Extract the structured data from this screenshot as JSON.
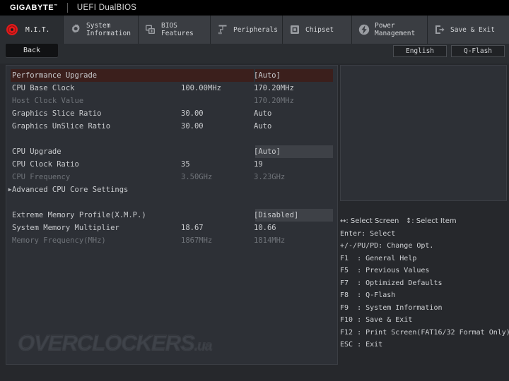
{
  "header": {
    "brand": "GIGABYTE",
    "trademark": "™",
    "subtitle": "UEFI DualBIOS"
  },
  "tabs": [
    {
      "label": "M.I.T.",
      "icon": "target-icon",
      "active": true
    },
    {
      "label": "System\nInformation",
      "icon": "gear-icon",
      "active": false
    },
    {
      "label": "BIOS\nFeatures",
      "icon": "chip-add-icon",
      "active": false
    },
    {
      "label": "Peripherals",
      "icon": "usb-plug-icon",
      "active": false
    },
    {
      "label": "Chipset",
      "icon": "chipset-icon",
      "active": false
    },
    {
      "label": "Power\nManagement",
      "icon": "power-bolt-icon",
      "active": false
    },
    {
      "label": "Save & Exit",
      "icon": "exit-arrow-icon",
      "active": false
    }
  ],
  "toolbar": {
    "back_label": "Back",
    "language_label": "English",
    "qflash_label": "Q-Flash"
  },
  "settings": {
    "groups": [
      {
        "rows": [
          {
            "label": "Performance Upgrade",
            "mid": "",
            "value": "[Auto]",
            "dim": false,
            "highlight": "red",
            "arrow": false
          },
          {
            "label": "CPU Base Clock",
            "mid": "100.00MHz",
            "value": "170.20MHz",
            "dim": false,
            "highlight": "none",
            "arrow": false
          },
          {
            "label": "Host Clock Value",
            "mid": "",
            "value": "170.20MHz",
            "dim": true,
            "highlight": "none",
            "arrow": false
          },
          {
            "label": "Graphics Slice Ratio",
            "mid": "30.00",
            "value": "Auto",
            "dim": false,
            "highlight": "none",
            "arrow": false
          },
          {
            "label": "Graphics UnSlice Ratio",
            "mid": "30.00",
            "value": "Auto",
            "dim": false,
            "highlight": "none",
            "arrow": false
          }
        ]
      },
      {
        "rows": [
          {
            "label": "CPU Upgrade",
            "mid": "",
            "value": "[Auto]",
            "dim": false,
            "highlight": "gray",
            "arrow": false
          },
          {
            "label": "CPU Clock Ratio",
            "mid": "35",
            "value": "19",
            "dim": false,
            "highlight": "none",
            "arrow": false
          },
          {
            "label": "CPU Frequency",
            "mid": "3.50GHz",
            "value": "3.23GHz",
            "dim": true,
            "highlight": "none",
            "arrow": false
          },
          {
            "label": "Advanced CPU Core Settings",
            "mid": "",
            "value": "",
            "dim": false,
            "highlight": "none",
            "arrow": true
          }
        ]
      },
      {
        "rows": [
          {
            "label": "Extreme Memory Profile(X.M.P.)",
            "mid": "",
            "value": "[Disabled]",
            "dim": false,
            "highlight": "gray",
            "arrow": false
          },
          {
            "label": "System Memory Multiplier",
            "mid": "18.67",
            "value": "10.66",
            "dim": false,
            "highlight": "none",
            "arrow": false
          },
          {
            "label": "Memory Frequency(MHz)",
            "mid": "1867MHz",
            "value": "1814MHz",
            "dim": true,
            "highlight": "none",
            "arrow": false
          }
        ]
      }
    ]
  },
  "help": {
    "lines": [
      "↔: Select Screen   ↕: Select Item",
      "Enter: Select",
      "+/-/PU/PD: Change Opt.",
      "F1  : General Help",
      "F5  : Previous Values",
      "F7  : Optimized Defaults",
      "F8  : Q-Flash",
      "F9  : System Information",
      "F10 : Save & Exit",
      "F12 : Print Screen(FAT16/32 Format Only)",
      "ESC : Exit"
    ]
  },
  "watermark": {
    "main": "OVERCLOCKERS",
    "suffix": ".ua"
  },
  "colors": {
    "accent_red": "#e01b1b",
    "selection_red": "#3b1f1c",
    "selection_gray": "#3e4147",
    "panel_bg": "#2d3036",
    "chrome_bg": "#2a2d31",
    "text": "#c9cbce",
    "text_dim": "#6f7379"
  }
}
